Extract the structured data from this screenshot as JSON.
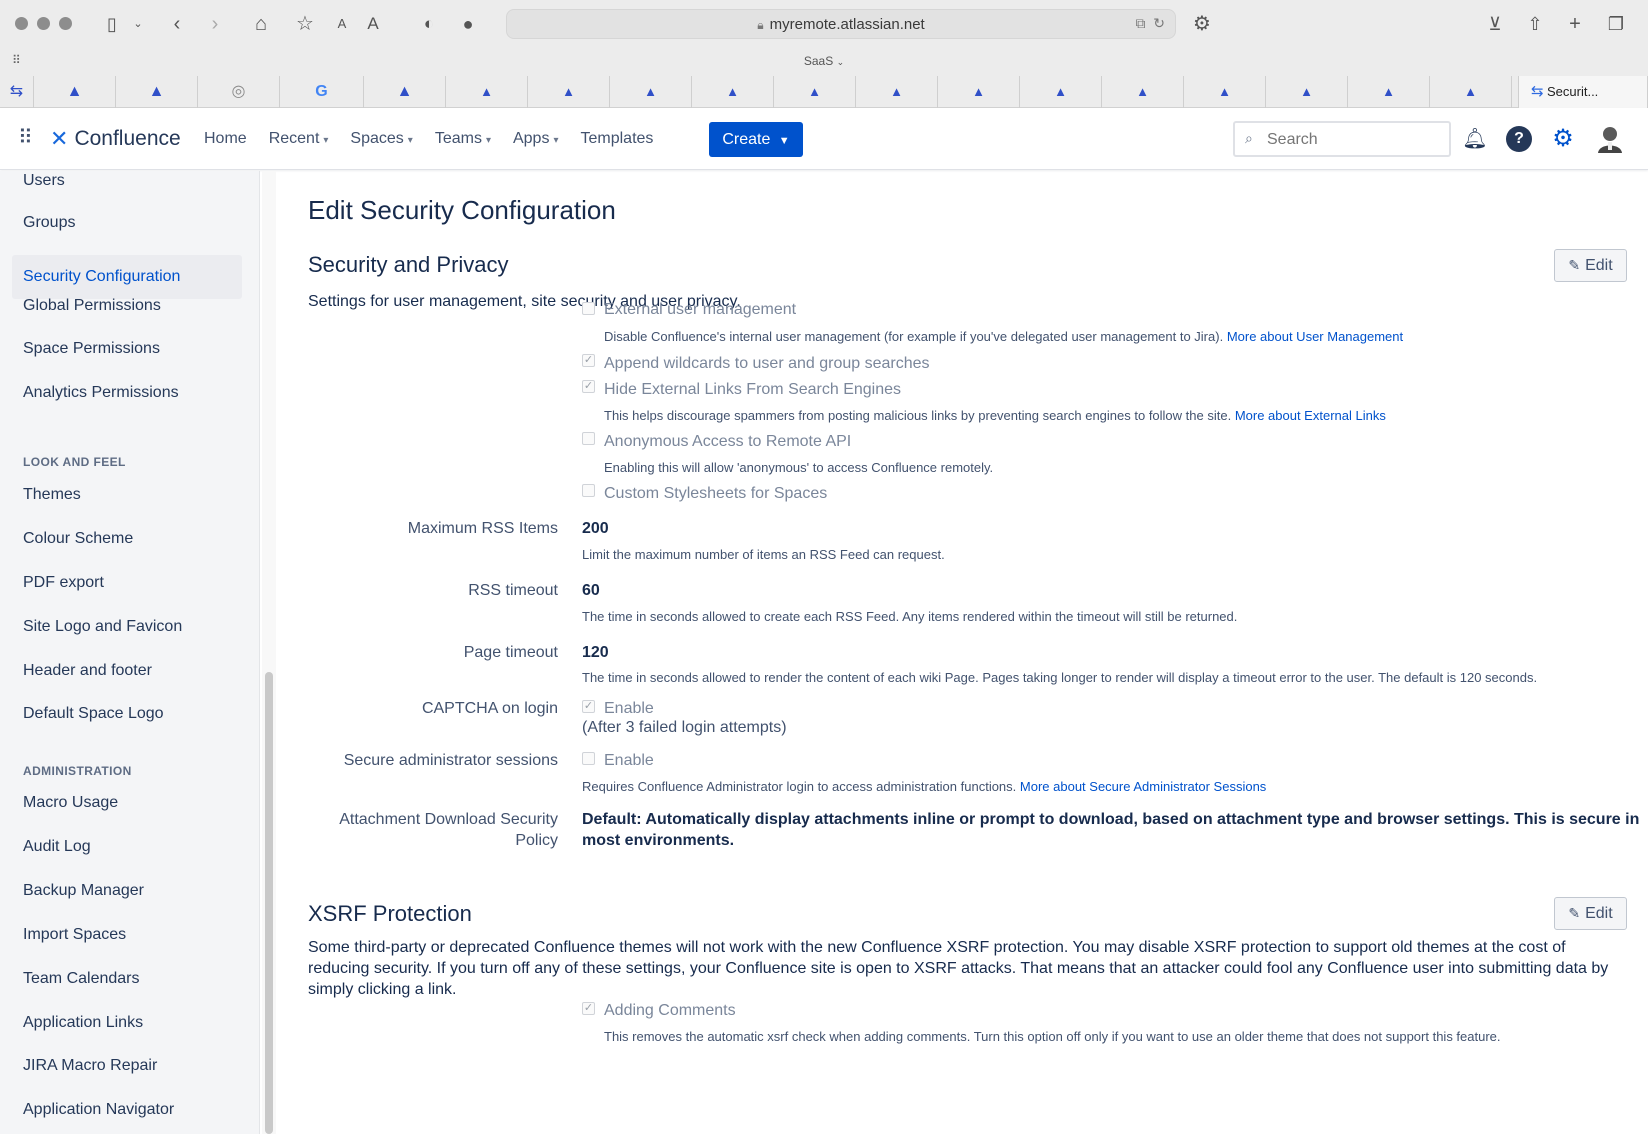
{
  "browser": {
    "url": "myremote.atlassian.net",
    "tab_group": "SaaS",
    "active_tab_title": "Securit..."
  },
  "app": {
    "product_name": "Confluence",
    "nav": [
      {
        "label": "Home"
      },
      {
        "label": "Recent"
      },
      {
        "label": "Spaces"
      },
      {
        "label": "Teams"
      },
      {
        "label": "Apps"
      },
      {
        "label": "Templates"
      }
    ],
    "create_label": "Create",
    "search_placeholder": "Search",
    "accent_color": "#0052cc"
  },
  "sidebar": {
    "items_top": [
      "Users",
      "Groups",
      "Security Configuration",
      "Global Permissions",
      "Space Permissions",
      "Analytics Permissions"
    ],
    "section_look": "LOOK AND FEEL",
    "items_look": [
      "Themes",
      "Colour Scheme",
      "PDF export",
      "Site Logo and Favicon",
      "Header and footer",
      "Default Space Logo"
    ],
    "section_admin": "ADMINISTRATION",
    "items_admin": [
      "Macro Usage",
      "Audit Log",
      "Backup Manager",
      "Import Spaces",
      "Team Calendars",
      "Application Links",
      "JIRA Macro Repair",
      "Application Navigator"
    ],
    "active_item": "Security Configuration"
  },
  "main": {
    "page_title": "Edit Security Configuration",
    "security": {
      "title": "Security and Privacy",
      "edit_label": "Edit",
      "intro": "Settings for user management, site security and user privacy.",
      "ext_user_mgmt": {
        "label": "External user management",
        "checked": false,
        "desc": "Disable Confluence's internal user management (for example if you've delegated user management to Jira).",
        "link": "More about User Management"
      },
      "append_wildcards": {
        "label": "Append wildcards to user and group searches",
        "checked": true
      },
      "hide_links": {
        "label": "Hide External Links From Search Engines",
        "checked": true,
        "desc": "This helps discourage spammers from posting malicious links by preventing search engines to follow the site.",
        "link": "More about External Links"
      },
      "anon_api": {
        "label": "Anonymous Access to Remote API",
        "checked": false,
        "desc": "Enabling this will allow 'anonymous' to access Confluence remotely."
      },
      "custom_css": {
        "label": "Custom Stylesheets for Spaces",
        "checked": false
      },
      "rss_items": {
        "label": "Maximum RSS Items",
        "value": "200",
        "desc": "Limit the maximum number of items an RSS Feed can request."
      },
      "rss_timeout": {
        "label": "RSS timeout",
        "value": "60",
        "desc": "The time in seconds allowed to create each RSS Feed. Any items rendered within the timeout will still be returned."
      },
      "page_timeout": {
        "label": "Page timeout",
        "value": "120",
        "desc": "The time in seconds allowed to render the content of each wiki Page. Pages taking longer to render will display a timeout error to the user. The default is 120 seconds."
      },
      "captcha": {
        "label": "CAPTCHA on login",
        "option": "Enable",
        "checked": true,
        "note": "(After 3 failed login attempts)"
      },
      "secure_admin": {
        "label": "Secure administrator sessions",
        "option": "Enable",
        "checked": false,
        "desc": "Requires Confluence Administrator login to access administration functions.",
        "link": "More about Secure Administrator Sessions"
      },
      "attach_policy": {
        "label_line1": "Attachment Download Security",
        "label_line2": "Policy",
        "value_line1": "Default: Automatically display attachments inline or prompt to download, based on attachment type and browser settings. This is secure in",
        "value_line2": "most environments."
      }
    },
    "xsrf": {
      "title": "XSRF Protection",
      "edit_label": "Edit",
      "intro_line1": "Some third-party or deprecated Confluence themes will not work with the new Confluence XSRF protection. You may disable XSRF protection to support old themes at the cost of",
      "intro_line2": "reducing security. If you turn off any of these settings, your Confluence site is open to XSRF attacks. That means that an attacker could fool any Confluence user into submitting data by",
      "intro_line3": "simply clicking a link.",
      "adding_comments": {
        "label": "Adding Comments",
        "checked": true,
        "desc": "This removes the automatic xsrf check when adding comments. Turn this option off only if you want to use an older theme that does not support this feature."
      }
    }
  }
}
